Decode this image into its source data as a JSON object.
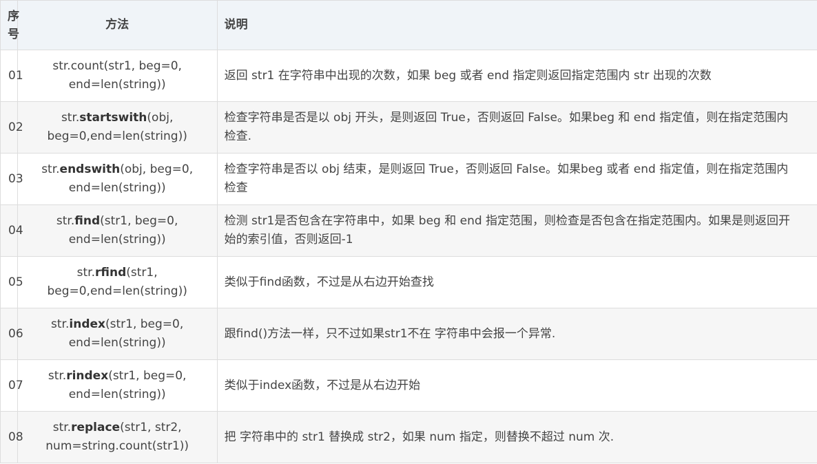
{
  "header": {
    "col_no": "序号",
    "col_method": "方法",
    "col_desc": "说明"
  },
  "rows": [
    {
      "no": "01",
      "method_prefix": "str.count(str1, beg=0, end=len(string))",
      "method_name": "",
      "method_suffix": "",
      "desc": "返回 str1 在字符串中出现的次数，如果 beg 或者 end 指定则返回指定范围内 str 出现的次数"
    },
    {
      "no": "02",
      "method_prefix": "str.",
      "method_name": "startswith",
      "method_suffix": "(obj, beg=0,end=len(string))",
      "desc": "检查字符串是否是以 obj 开头，是则返回 True，否则返回 False。如果beg 和 end 指定值，则在指定范围内检查."
    },
    {
      "no": "03",
      "method_prefix": "str.",
      "method_name": "endswith",
      "method_suffix": "(obj, beg=0, end=len(string))",
      "desc": "检查字符串是否以 obj 结束，是则返回 True，否则返回 False。如果beg 或者 end 指定值，则在指定范围内检查"
    },
    {
      "no": "04",
      "method_prefix": "str.",
      "method_name": "find",
      "method_suffix": "(str1, beg=0, end=len(string))",
      "desc": "检测 str1是否包含在字符串中，如果 beg 和 end 指定范围，则检查是否包含在指定范围内。如果是则返回开始的索引值，否则返回-1"
    },
    {
      "no": "05",
      "method_prefix": "str.",
      "method_name": "rfind",
      "method_suffix": "(str1, beg=0,end=len(string))",
      "desc": "类似于find函数，不过是从右边开始查找"
    },
    {
      "no": "06",
      "method_prefix": "str.",
      "method_name": "index",
      "method_suffix": "(str1, beg=0, end=len(string))",
      "desc": "跟find()方法一样，只不过如果str1不在 字符串中会报一个异常."
    },
    {
      "no": "07",
      "method_prefix": "str.",
      "method_name": "rindex",
      "method_suffix": "(str1, beg=0, end=len(string))",
      "desc": "类似于index函数，不过是从右边开始"
    },
    {
      "no": "08",
      "method_prefix": "str.",
      "method_name": "replace",
      "method_suffix": "(str1, str2, num=string.count(str1))",
      "desc": "把 字符串中的 str1 替换成 str2，如果 num 指定，则替换不超过 num 次."
    }
  ]
}
